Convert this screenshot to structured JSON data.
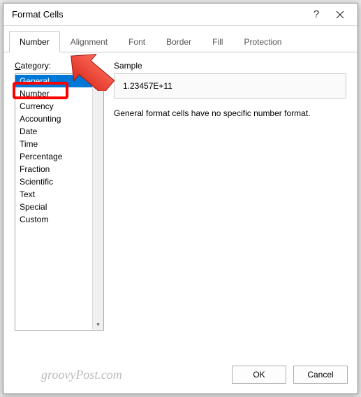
{
  "dialog": {
    "title": "Format Cells"
  },
  "tabs": {
    "items": [
      {
        "label": "Number"
      },
      {
        "label": "Alignment"
      },
      {
        "label": "Font"
      },
      {
        "label": "Border"
      },
      {
        "label": "Fill"
      },
      {
        "label": "Protection"
      }
    ],
    "active_index": 0
  },
  "category": {
    "label_prefix": "C",
    "label_rest": "ategory:",
    "items": [
      "General",
      "Number",
      "Currency",
      "Accounting",
      "Date",
      "Time",
      "Percentage",
      "Fraction",
      "Scientific",
      "Text",
      "Special",
      "Custom"
    ],
    "selected_index": 0,
    "highlighted_item": "Number"
  },
  "sample": {
    "label": "Sample",
    "value": "1.23457E+11"
  },
  "description": "General format cells have no specific number format.",
  "buttons": {
    "ok": "OK",
    "cancel": "Cancel"
  },
  "watermark": "groovyPost.com",
  "icons": {
    "help": "?",
    "close": "close-icon",
    "scroll_up": "▴",
    "scroll_down": "▾"
  }
}
